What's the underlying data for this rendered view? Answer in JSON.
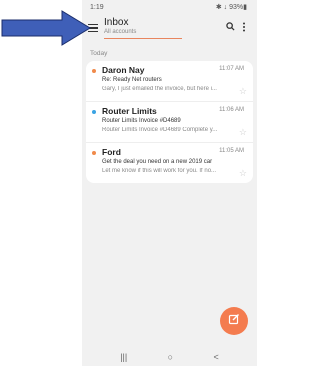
{
  "status": {
    "time": "1:19",
    "icons": "✱ ↓ 93%▮"
  },
  "header": {
    "title": "Inbox",
    "subtitle": "All accounts"
  },
  "section": {
    "label": "Today"
  },
  "emails": [
    {
      "sender": "Daron Nay",
      "time": "11:07 AM",
      "subject": "Re: Ready Net routers",
      "preview": "Gary,  I just emailed the invoice, but here i...",
      "dot_color": "#f08a4b"
    },
    {
      "sender": "Router Limits",
      "time": "11:06 AM",
      "subject": "Router Limits Invoice #D4689",
      "preview": "Router Limits Invoice #D4689 Complete y...",
      "dot_color": "#3aa3e3"
    },
    {
      "sender": "Ford",
      "time": "11:05 AM",
      "subject": "Get the deal you need on a new 2019 car",
      "preview": "Let me know if this will work for you. If no...",
      "dot_color": "#f08a4b"
    }
  ],
  "colors": {
    "accent": "#f47c4f",
    "arrow": "#3f5fb8"
  },
  "icons": {
    "menu": "hamburger-icon",
    "search": "search-icon",
    "more": "more-vert-icon",
    "compose": "compose-icon"
  },
  "nav": {
    "recents": "|||",
    "home": "○",
    "back": "<"
  }
}
